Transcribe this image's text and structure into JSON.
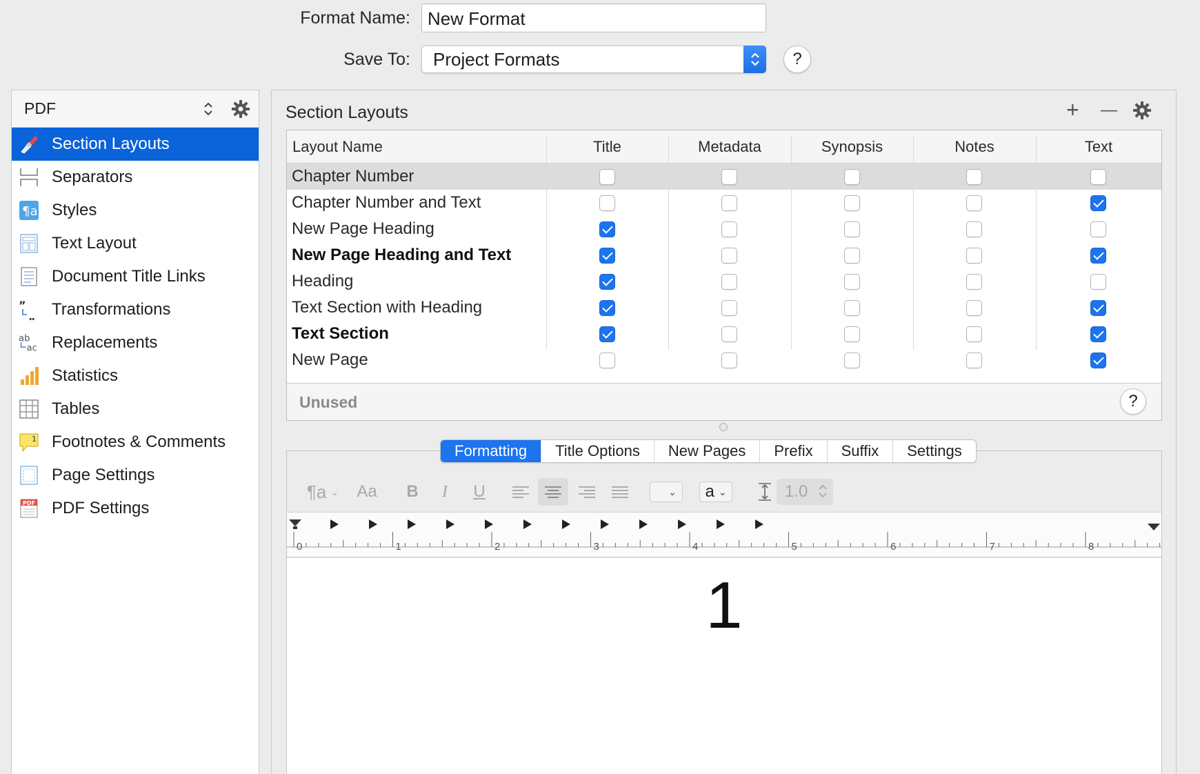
{
  "form": {
    "format_name_label": "Format Name:",
    "format_name_value": "New Format",
    "save_to_label": "Save To:",
    "save_to_value": "Project Formats",
    "help_label": "?"
  },
  "sidebar": {
    "format_type": "PDF",
    "items": [
      {
        "label": "Section Layouts",
        "icon": "brush-icon",
        "selected": true
      },
      {
        "label": "Separators",
        "icon": "separators-icon"
      },
      {
        "label": "Styles",
        "icon": "styles-icon"
      },
      {
        "label": "Text Layout",
        "icon": "text-layout-icon"
      },
      {
        "label": "Document Title Links",
        "icon": "document-icon"
      },
      {
        "label": "Transformations",
        "icon": "quotes-icon"
      },
      {
        "label": "Replacements",
        "icon": "replace-icon"
      },
      {
        "label": "Statistics",
        "icon": "bar-chart-icon"
      },
      {
        "label": "Tables",
        "icon": "table-icon"
      },
      {
        "label": "Footnotes & Comments",
        "icon": "footnote-icon"
      },
      {
        "label": "Page Settings",
        "icon": "page-icon"
      },
      {
        "label": "PDF Settings",
        "icon": "pdf-icon"
      }
    ]
  },
  "section_layouts": {
    "title": "Section Layouts",
    "add": "+",
    "remove": "—",
    "columns": [
      "Layout Name",
      "Title",
      "Metadata",
      "Synopsis",
      "Notes",
      "Text"
    ],
    "rows": [
      {
        "name": "Chapter Number",
        "bold": false,
        "checks": [
          false,
          false,
          false,
          false,
          false
        ]
      },
      {
        "name": "Chapter Number and Text",
        "bold": false,
        "checks": [
          false,
          false,
          false,
          false,
          true
        ]
      },
      {
        "name": "New Page Heading",
        "bold": false,
        "checks": [
          true,
          false,
          false,
          false,
          false
        ]
      },
      {
        "name": "New Page Heading and Text",
        "bold": true,
        "checks": [
          true,
          false,
          false,
          false,
          true
        ]
      },
      {
        "name": "Heading",
        "bold": false,
        "checks": [
          true,
          false,
          false,
          false,
          false
        ]
      },
      {
        "name": "Text Section with Heading",
        "bold": false,
        "checks": [
          true,
          false,
          false,
          false,
          true
        ]
      },
      {
        "name": "Text Section",
        "bold": true,
        "checks": [
          true,
          false,
          false,
          false,
          true
        ]
      },
      {
        "name": "New Page",
        "bold": false,
        "checks": [
          false,
          false,
          false,
          false,
          true
        ]
      }
    ],
    "unused_label": "Unused",
    "help_label": "?"
  },
  "tabs": [
    "Formatting",
    "Title Options",
    "New Pages",
    "Prefix",
    "Suffix",
    "Settings"
  ],
  "active_tab": 0,
  "toolbar": {
    "font_size_label": "Aa",
    "bold": "B",
    "italic": "I",
    "underline": "U",
    "text_color_label": "a",
    "line_spacing": "1.0"
  },
  "ruler": {
    "numbers": [
      "0",
      "1",
      "2",
      "3",
      "4",
      "5",
      "6",
      "7",
      "8"
    ]
  },
  "preview_text": "1"
}
